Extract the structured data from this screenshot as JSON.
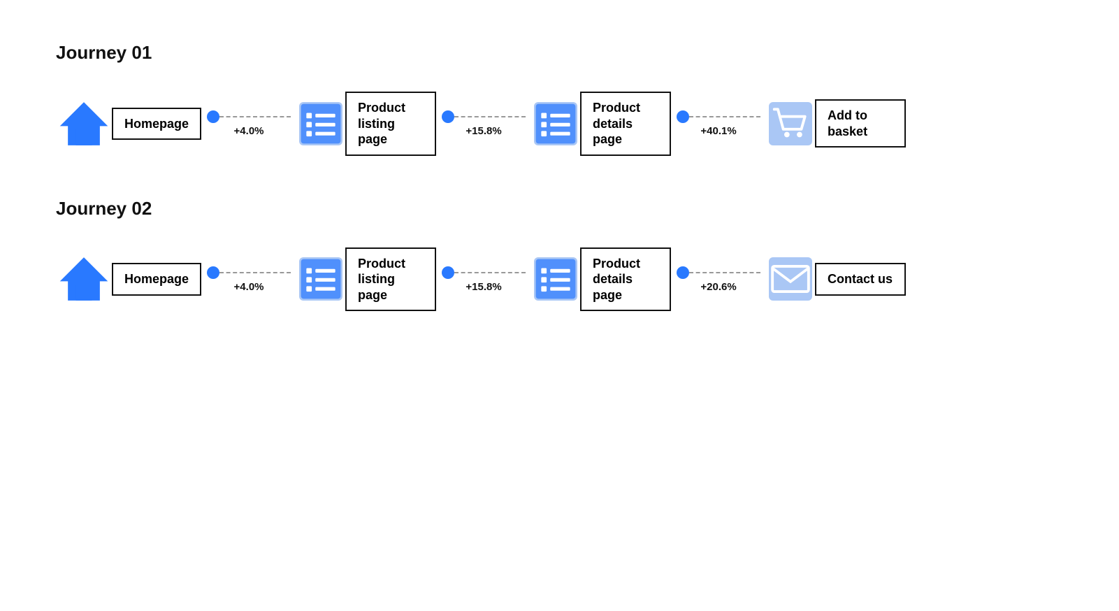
{
  "journeys": [
    {
      "id": "journey-01",
      "title": "Journey 01",
      "nodes": [
        {
          "type": "home",
          "label": "Homepage",
          "multiline": false
        },
        {
          "type": "list",
          "label": "Product listing page",
          "multiline": true,
          "pct": "+4.0%"
        },
        {
          "type": "list",
          "label": "Product details page",
          "multiline": true,
          "pct": "+15.8%"
        },
        {
          "type": "cart",
          "label": "Add to basket",
          "multiline": true,
          "pct": "+40.1%"
        }
      ]
    },
    {
      "id": "journey-02",
      "title": "Journey 02",
      "nodes": [
        {
          "type": "home",
          "label": "Homepage",
          "multiline": false
        },
        {
          "type": "list",
          "label": "Product listing page",
          "multiline": true,
          "pct": "+4.0%"
        },
        {
          "type": "list",
          "label": "Product details page",
          "multiline": true,
          "pct": "+15.8%"
        },
        {
          "type": "mail",
          "label": "Contact us",
          "multiline": true,
          "pct": "+20.6%"
        }
      ]
    }
  ]
}
